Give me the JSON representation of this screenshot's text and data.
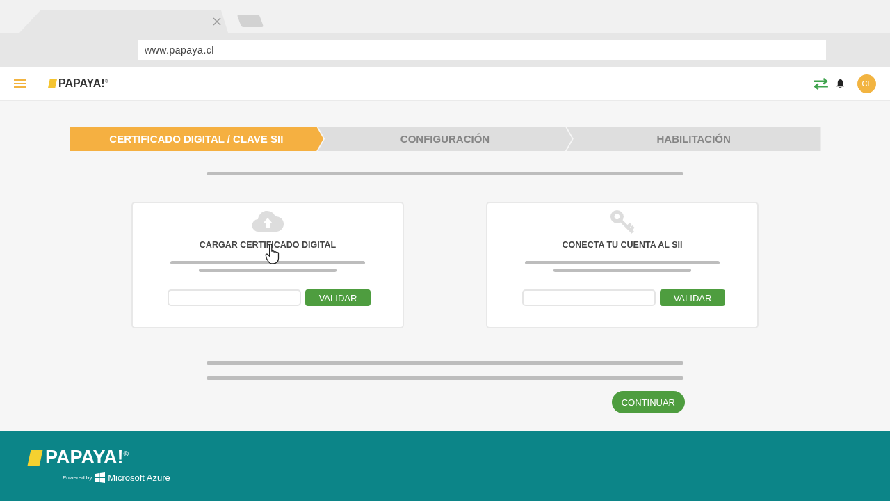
{
  "browser": {
    "url": "www.papaya.cl"
  },
  "header": {
    "logo": "PAPAYA!$^{®}$",
    "avatar": "CL"
  },
  "steps": [
    {
      "label": "CERTIFICADO DIGITAL / CLAVE SII",
      "selected": true
    },
    {
      "label": "CONFIGURACIÓN",
      "selected": false
    },
    {
      "label": "HABILITACIÓN",
      "selected": false
    }
  ],
  "cards": [
    {
      "kind": "upload",
      "title": "CARGAR CERTIFICADO DIGITAL",
      "button": "VALIDAR"
    },
    {
      "kind": "key",
      "title": "CONECTA TU CUENTA AL SII",
      "button": "VALIDAR"
    }
  ],
  "continue_button": "CONTINUAR",
  "footer": {
    "logo": "PAPAYA!$^{®}$",
    "powered_by": "Powered by",
    "partner": "Microsoft Azure"
  }
}
